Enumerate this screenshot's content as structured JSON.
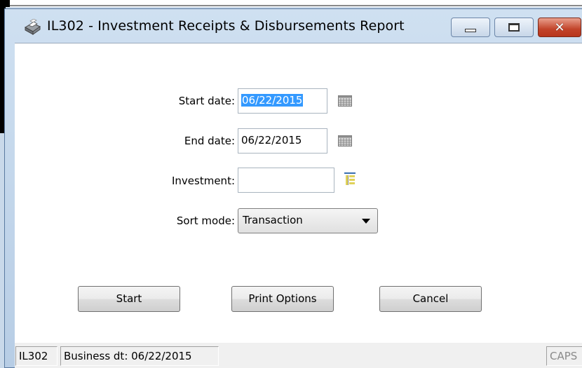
{
  "window": {
    "title": "IL302 - Investment Receipts & Disbursements Report",
    "icon": "printer-icon"
  },
  "form": {
    "start_date_label": "Start date:",
    "start_date_value": "06/22/2015",
    "end_date_label": "End date:",
    "end_date_value": "06/22/2015",
    "investment_label": "Investment:",
    "investment_value": "",
    "sort_mode_label": "Sort mode:",
    "sort_mode_value": "Transaction"
  },
  "buttons": {
    "start": "Start",
    "print_options": "Print Options",
    "cancel": "Cancel"
  },
  "statusbar": {
    "code": "IL302",
    "business_date": "Business dt: 06/22/2015",
    "caps": "CAPS"
  },
  "colors": {
    "selection": "#3399ff",
    "close_button": "#c2432a",
    "frame": "#c9d9ea"
  }
}
